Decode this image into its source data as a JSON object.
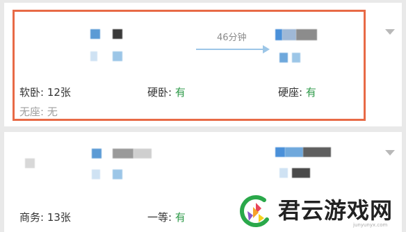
{
  "train1": {
    "duration": "46分钟",
    "seats": [
      {
        "label": "软卧: ",
        "value": "12张"
      },
      {
        "label": "硬卧: ",
        "value": "有"
      },
      {
        "label": "硬座: ",
        "value": "有"
      },
      {
        "label": "无座: ",
        "value": "无"
      }
    ]
  },
  "train2": {
    "seats": [
      {
        "label": "商务: ",
        "value": "13张"
      },
      {
        "label": "一等: ",
        "value": "有"
      }
    ]
  },
  "watermark": {
    "title": "君云游戏网",
    "url": "junyunyx.com"
  },
  "colors": {
    "highlight": "#e86a46",
    "available": "#2d9a48",
    "arrow": "#9cc6e7"
  },
  "icons": {
    "expand": "chevron-down-icon",
    "logo": "colorful-c-logo-icon"
  }
}
